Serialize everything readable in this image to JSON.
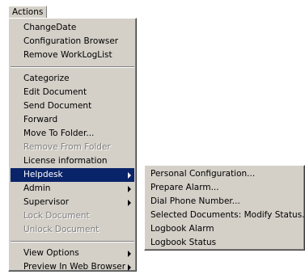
{
  "menubar": {
    "actions_label": "Actions"
  },
  "actions_menu": {
    "items": [
      {
        "label": "ChangeDate"
      },
      {
        "label": "Configuration Browser"
      },
      {
        "label": "Remove WorkLogList"
      },
      {
        "label": "Categorize"
      },
      {
        "label": "Edit Document"
      },
      {
        "label": "Send Document"
      },
      {
        "label": "Forward"
      },
      {
        "label": "Move To Folder..."
      },
      {
        "label": "Remove From Folder"
      },
      {
        "label": "License information"
      },
      {
        "label": "Helpdesk"
      },
      {
        "label": "Admin"
      },
      {
        "label": "Supervisor"
      },
      {
        "label": "Lock Document"
      },
      {
        "label": "Unlock Document"
      },
      {
        "label": "View Options"
      },
      {
        "label": "Preview In Web Browser"
      }
    ]
  },
  "helpdesk_submenu": {
    "items": [
      {
        "label": "Personal Configuration..."
      },
      {
        "label": "Prepare Alarm..."
      },
      {
        "label": "Dial Phone Number..."
      },
      {
        "label": "Selected Documents: Modify Status..."
      },
      {
        "label": "Logbook Alarm"
      },
      {
        "label": "Logbook Status"
      }
    ]
  },
  "colors": {
    "menu_background": "#d4d0c8",
    "highlight_background": "#0a246a",
    "highlight_text": "#ffffff",
    "disabled_text": "#808080"
  },
  "icons": {
    "submenu_arrow": "chevron-right-icon"
  }
}
